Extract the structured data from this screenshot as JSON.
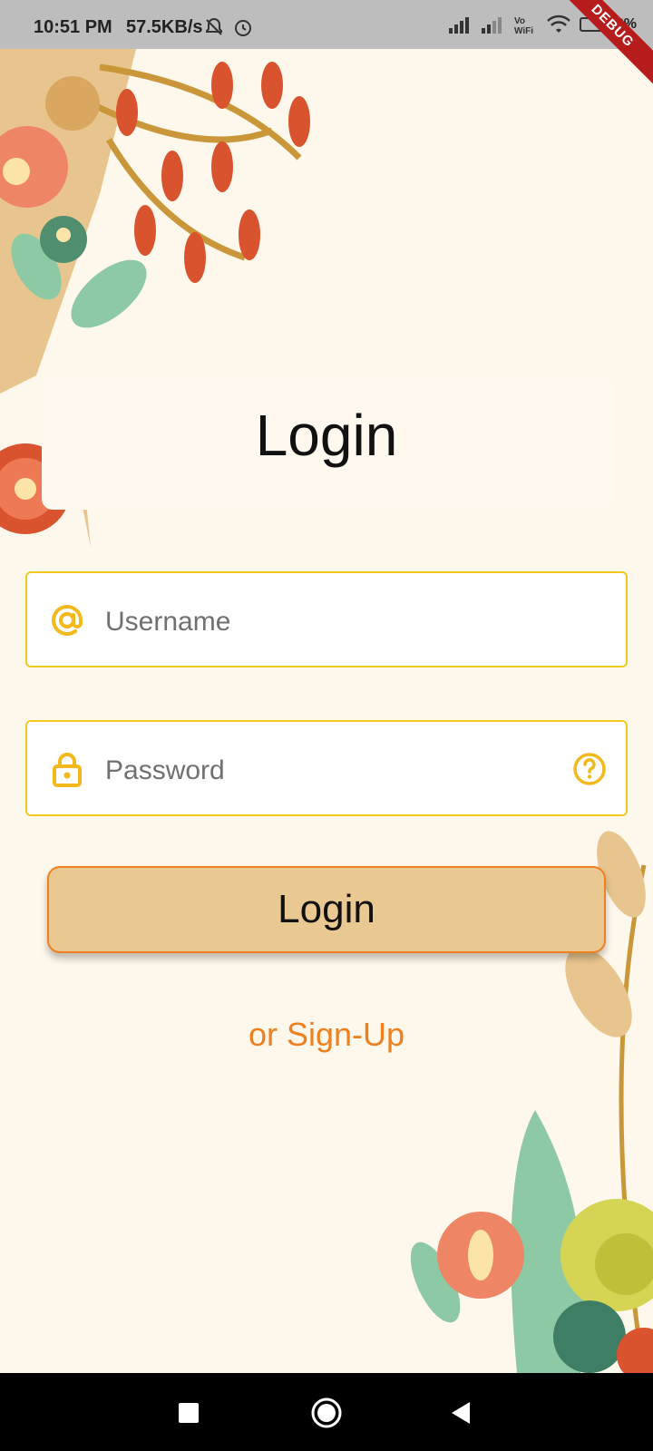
{
  "status_bar": {
    "time": "10:51 PM",
    "network_speed": "57.5KB/s",
    "battery": "3%",
    "debug_banner": "DEBUG"
  },
  "login": {
    "title": "Login",
    "username_placeholder": "Username",
    "password_placeholder": "Password",
    "login_button": "Login",
    "signup_link": "or Sign-Up"
  },
  "colors": {
    "background": "#FEF7EC",
    "accent_yellow": "#F2C81C",
    "accent_orange": "#EE8020",
    "button_fill": "#EAC891"
  },
  "icons": {
    "username": "at-icon",
    "password": "lock-icon",
    "help": "question-icon"
  }
}
